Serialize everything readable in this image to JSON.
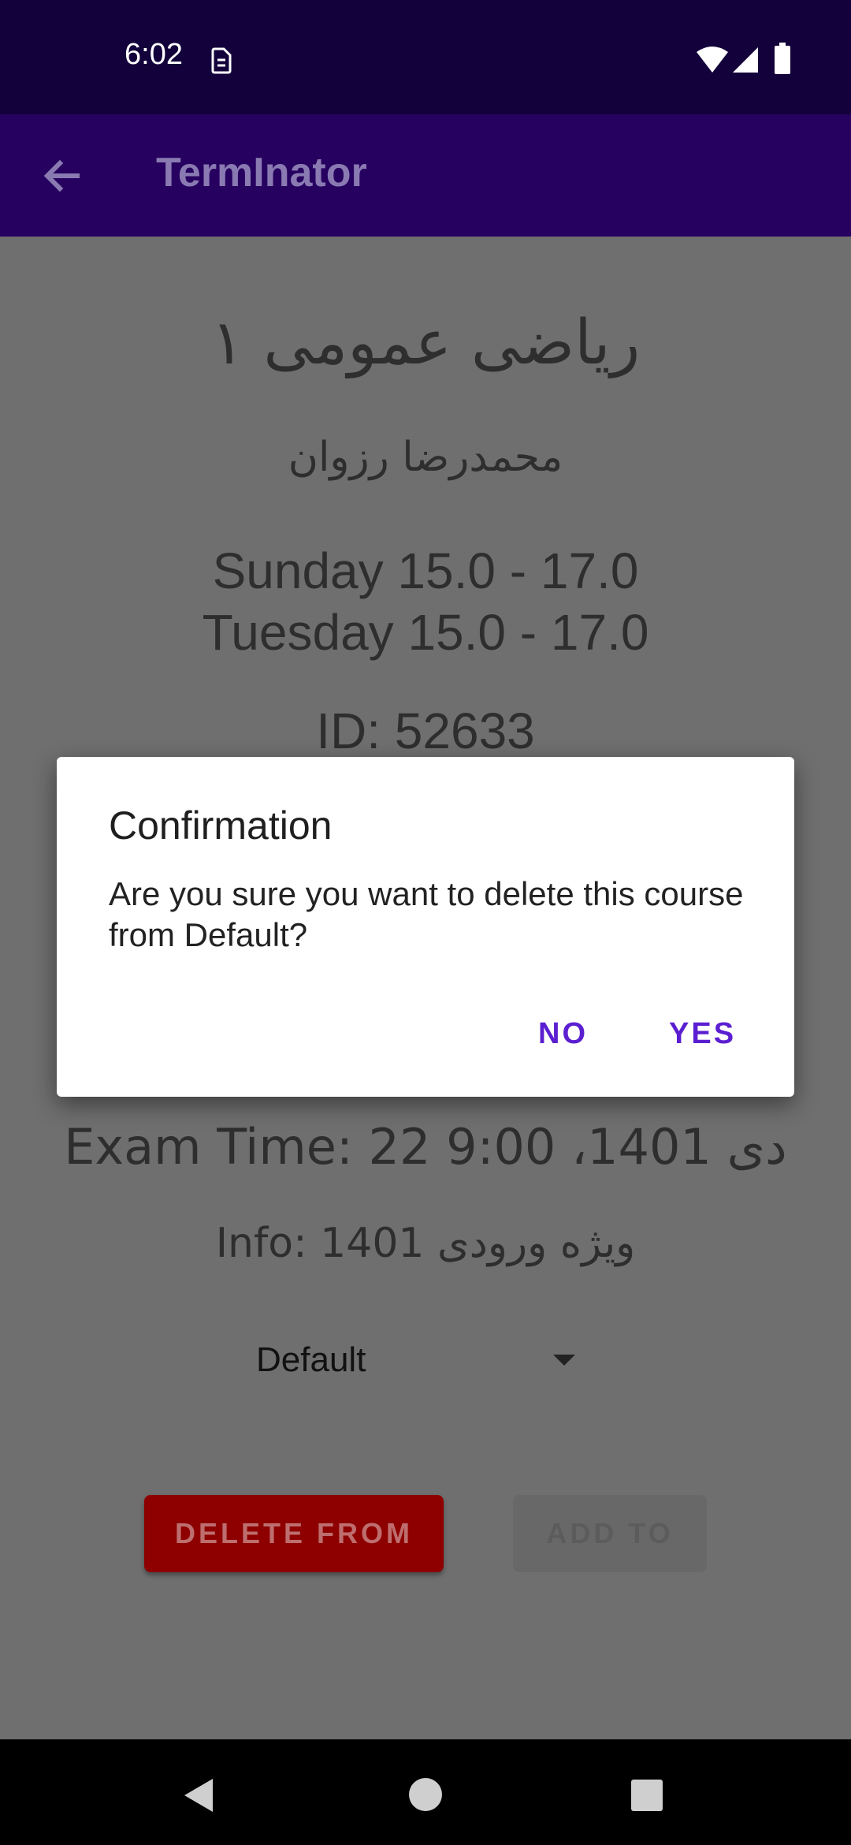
{
  "status_bar": {
    "time": "6:02",
    "icons": [
      "sim-icon",
      "wifi-icon",
      "signal-icon",
      "battery-icon"
    ]
  },
  "app_bar": {
    "title": "TermInator",
    "back_icon": "back-arrow-icon"
  },
  "course": {
    "name": "ریاضی عمومی ۱",
    "instructor": "محمدرضا رزوان",
    "schedule": [
      "Sunday 15.0 - 17.0",
      "Tuesday 15.0 - 17.0"
    ],
    "id": "ID: 52633",
    "exam_time": "Exam Time: 22 دی 1401، 9:00",
    "info": "Info: 1401 ویژه ورودی"
  },
  "term_select": {
    "selected": "Default"
  },
  "actions": {
    "delete_label": "DELETE FROM",
    "add_label": "ADD TO"
  },
  "dialog": {
    "title": "Confirmation",
    "message": "Are you sure you want to delete this course from Default?",
    "no_label": "NO",
    "yes_label": "YES"
  },
  "nav_bar": {
    "icons": [
      "back-triangle-icon",
      "home-circle-icon",
      "recents-square-icon"
    ]
  },
  "colors": {
    "status_bar": "#12013a",
    "app_bar": "#270160",
    "delete_button": "#8e0000",
    "dialog_accent": "#5b1fd1"
  }
}
